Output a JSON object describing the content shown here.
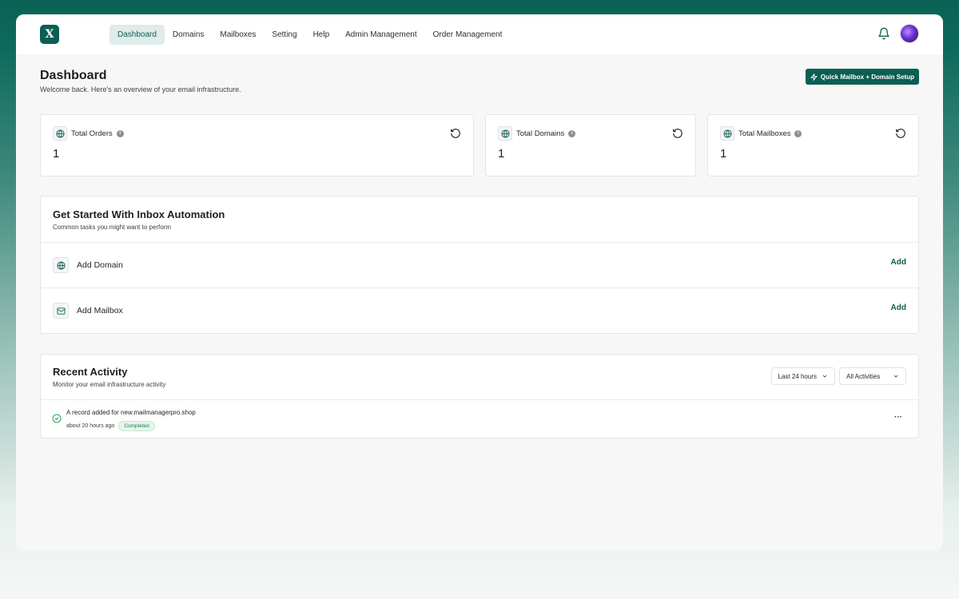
{
  "nav": {
    "items": [
      {
        "label": "Dashboard",
        "active": true
      },
      {
        "label": "Domains",
        "active": false
      },
      {
        "label": "Mailboxes",
        "active": false
      },
      {
        "label": "Setting",
        "active": false
      },
      {
        "label": "Help",
        "active": false
      },
      {
        "label": "Admin Management",
        "active": false
      },
      {
        "label": "Order Management",
        "active": false
      }
    ]
  },
  "header": {
    "title": "Dashboard",
    "subtitle": "Welcome back. Here's an overview of your email infrastructure.",
    "quick_button": "Quick Mailbox + Domain Setup"
  },
  "stats": [
    {
      "label": "Total Orders",
      "value": "1"
    },
    {
      "label": "Total Domains",
      "value": "1"
    },
    {
      "label": "Total Mailboxes",
      "value": "1"
    }
  ],
  "get_started": {
    "title": "Get Started With Inbox Automation",
    "subtitle": "Common tasks you might want to perform",
    "tasks": [
      {
        "label": "Add Domain",
        "action": "Add",
        "icon": "globe-icon"
      },
      {
        "label": "Add Mailbox",
        "action": "Add",
        "icon": "mail-icon"
      }
    ]
  },
  "recent_activity": {
    "title": "Recent Activity",
    "subtitle": "Monitor your email infrastructure activity",
    "time_filter": "Last 24 hours",
    "type_filter": "All Activities",
    "items": [
      {
        "text": "A record added for new.mailmanagerpro.shop",
        "time": "about 20 hours ago",
        "status": "Completed"
      }
    ]
  },
  "colors": {
    "brand": "#0b5e52",
    "active_nav_bg": "#dfece9",
    "success": "#1e7a44"
  }
}
